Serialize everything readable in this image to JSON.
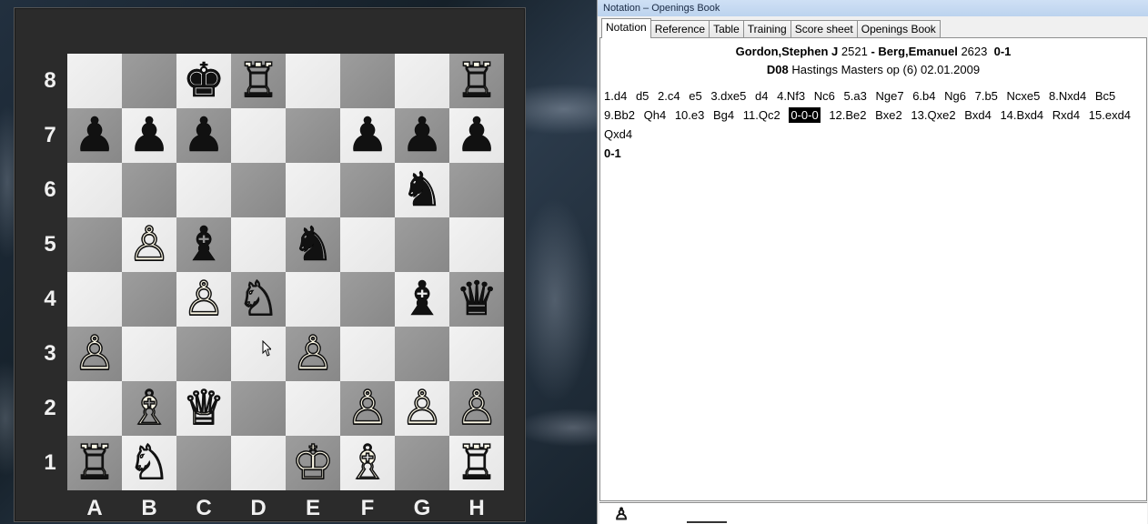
{
  "board": {
    "ranks": [
      "8",
      "7",
      "6",
      "5",
      "4",
      "3",
      "2",
      "1"
    ],
    "files": [
      "A",
      "B",
      "C",
      "D",
      "E",
      "F",
      "G",
      "H"
    ],
    "squares": [
      [
        "",
        "",
        "♚b",
        "♖w",
        "",
        "",
        "",
        "♖w"
      ],
      [
        "♟b",
        "♟b",
        "♟b",
        "",
        "",
        "♟b",
        "♟b",
        "♟b"
      ],
      [
        "",
        "",
        "",
        "",
        "",
        "",
        "♞b",
        ""
      ],
      [
        "",
        "♙w",
        "♝b",
        "",
        "♞b",
        "",
        "",
        ""
      ],
      [
        "",
        "",
        "♙w",
        "♘w",
        "",
        "",
        "♝b",
        "♛b"
      ],
      [
        "♙w",
        "",
        "",
        "",
        "♙w",
        "",
        "",
        ""
      ],
      [
        "",
        "♗w",
        "♕w",
        "",
        "",
        "♙w",
        "♙w",
        "♙w"
      ],
      [
        "♖w",
        "♘w",
        "",
        "",
        "♔w",
        "♗w",
        "",
        "♖w"
      ]
    ]
  },
  "panel": {
    "title": "Notation – Openings Book",
    "tabs": [
      "Notation",
      "Reference",
      "Table",
      "Training",
      "Score sheet",
      "Openings Book"
    ],
    "active_tab": "Notation",
    "white_player": "Gordon,Stephen J",
    "white_elo": "2521",
    "separator": "-",
    "black_player": "Berg,Emanuel",
    "black_elo": "2623",
    "result": "0-1",
    "eco": "D08",
    "event": "Hastings Masters op (6) 02.01.2009",
    "moves": [
      "1.d4",
      "d5",
      "2.c4",
      "e5",
      "3.dxe5",
      "d4",
      "4.Nf3",
      "Nc6",
      "5.a3",
      "Nge7",
      "6.b4",
      "Ng6",
      "7.b5",
      "Ncxe5",
      "8.Nxd4",
      "Bc5",
      "9.Bb2",
      "Qh4",
      "10.e3",
      "Bg4",
      "11.Qc2",
      "0-0-0",
      "12.Be2",
      "Bxe2",
      "13.Qxe2",
      "Bxd4",
      "14.Bxd4",
      "Rxd4",
      "15.exd4",
      "Qxd4"
    ],
    "highlighted_move": "0-0-0",
    "final_result": "0-1"
  },
  "icons": {
    "bottom_piece": "♙"
  }
}
